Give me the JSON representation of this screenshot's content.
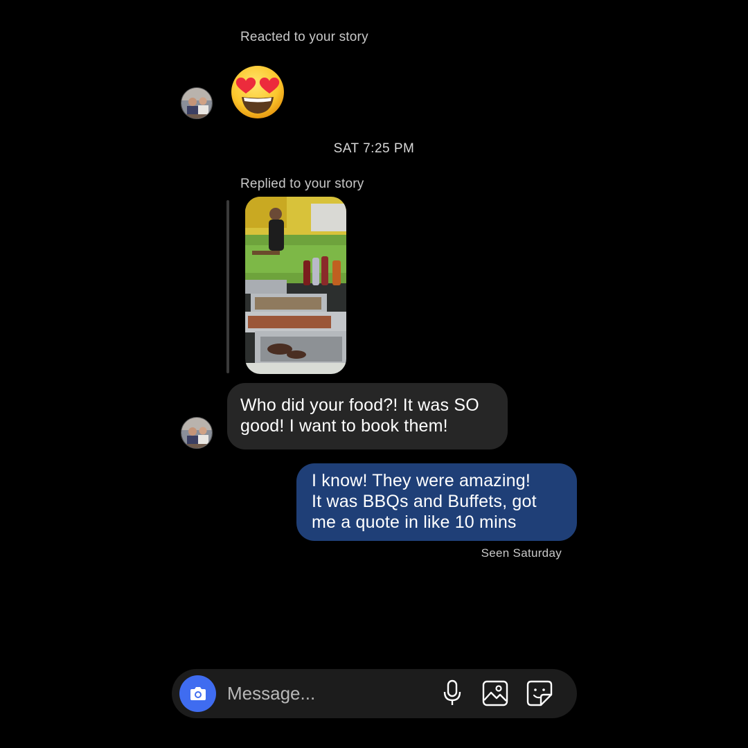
{
  "thread": {
    "reaction_caption": "Reacted to your story",
    "reaction_emoji_name": "heart-eyes-emoji",
    "timestamp": "SAT 7:25 PM",
    "reply_caption": "Replied to your story",
    "incoming_message": "Who did your food?! It was SO\ngood! I want to book them!",
    "outgoing_message": "I know! They were amazing!\nIt was BBQs and Buffets, got\nme a quote in like 10 mins",
    "seen_status": "Seen Saturday"
  },
  "composer": {
    "placeholder": "Message...",
    "icons": [
      "camera-icon",
      "microphone-icon",
      "gallery-icon",
      "sticker-icon"
    ]
  },
  "colors": {
    "background": "#000000",
    "incoming_bubble": "#262626",
    "outgoing_bubble": "#1f3f77",
    "camera_button": "#3f6cf0",
    "composer": "#1c1c1c"
  }
}
